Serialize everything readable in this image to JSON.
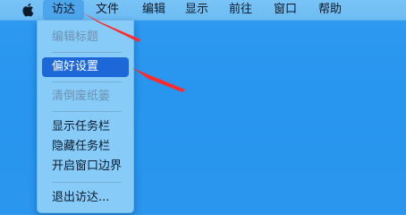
{
  "menubar": {
    "items": [
      {
        "label": "访达"
      },
      {
        "label": "文件"
      },
      {
        "label": "编辑"
      },
      {
        "label": "显示"
      },
      {
        "label": "前往"
      },
      {
        "label": "窗口"
      },
      {
        "label": "帮助"
      }
    ]
  },
  "finder_menu": {
    "items": [
      {
        "label": "编辑标题"
      },
      {
        "label": "偏好设置"
      },
      {
        "label": "清倒废纸篓"
      },
      {
        "label": "显示任务栏"
      },
      {
        "label": "隐藏任务栏"
      },
      {
        "label": "开启窗口边界"
      },
      {
        "label": "退出访达..."
      }
    ]
  },
  "colors": {
    "desktop": "#2a96ee",
    "menubar": "#6cbcf4",
    "selection": "#1d68d8",
    "annotation_arrow": "#ff2a2a"
  }
}
